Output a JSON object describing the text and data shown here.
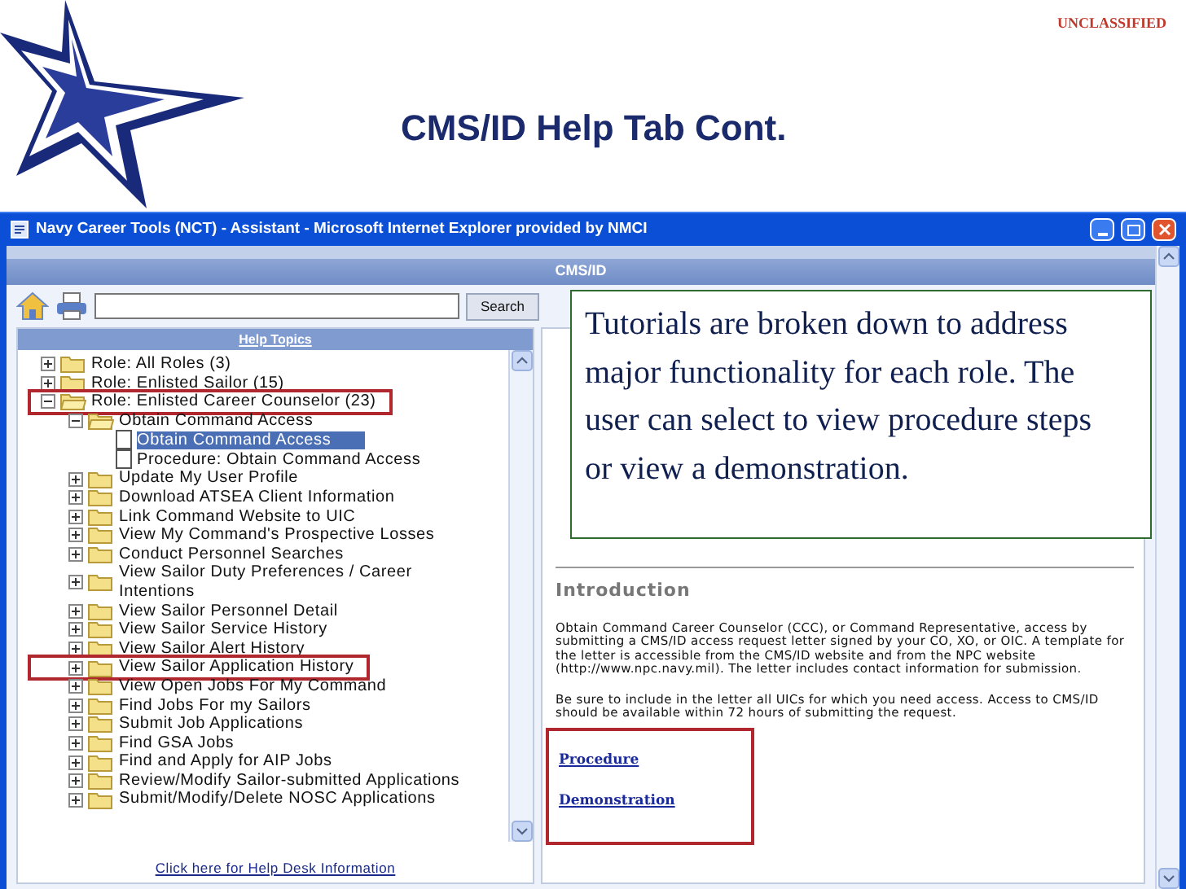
{
  "classification": "UNCLASSIFIED",
  "slide_title": "CMS/ID Help Tab Cont.",
  "window": {
    "title": "Navy Career Tools (NCT) - Assistant - Microsoft Internet Explorer provided by NMCI"
  },
  "page_header": "CMS/ID",
  "search": {
    "button": "Search"
  },
  "tree": {
    "title": "Help Topics",
    "items": [
      {
        "label": "Role: All Roles (3)",
        "kind": "folder",
        "expanded": false,
        "selected": false,
        "highlighted": false
      },
      {
        "label": "Role: Enlisted Sailor (15)",
        "kind": "folder",
        "expanded": false,
        "selected": false,
        "highlighted": false
      },
      {
        "label": "Role: Enlisted Career Counselor (23)",
        "kind": "folder",
        "expanded": true,
        "selected": false,
        "highlighted": true,
        "children": [
          {
            "label": "Obtain Command Access",
            "kind": "folder",
            "expanded": true,
            "selected": false,
            "highlighted": false,
            "children": [
              {
                "label": "Obtain Command Access",
                "kind": "doc",
                "selected": true,
                "highlighted": false
              },
              {
                "label": "Procedure: Obtain Command Access",
                "kind": "doc",
                "selected": false,
                "highlighted": false
              }
            ]
          },
          {
            "label": "Update My User Profile",
            "kind": "folder",
            "expanded": false,
            "selected": false,
            "highlighted": false
          },
          {
            "label": "Download ATSEA Client Information",
            "kind": "folder",
            "expanded": false,
            "selected": false,
            "highlighted": false
          },
          {
            "label": "Link Command Website to UIC",
            "kind": "folder",
            "expanded": false,
            "selected": false,
            "highlighted": false
          },
          {
            "label": "View My Command's Prospective Losses",
            "kind": "folder",
            "expanded": false,
            "selected": false,
            "highlighted": false
          },
          {
            "label": "Conduct Personnel Searches",
            "kind": "folder",
            "expanded": false,
            "selected": false,
            "highlighted": false
          },
          {
            "label": "View Sailor Duty Preferences / Career Intentions",
            "kind": "folder",
            "expanded": false,
            "selected": false,
            "highlighted": false
          },
          {
            "label": "View Sailor Personnel Detail",
            "kind": "folder",
            "expanded": false,
            "selected": false,
            "highlighted": false
          },
          {
            "label": "View Sailor Service History",
            "kind": "folder",
            "expanded": false,
            "selected": false,
            "highlighted": false
          },
          {
            "label": "View Sailor Alert History",
            "kind": "folder",
            "expanded": false,
            "selected": false,
            "highlighted": false
          },
          {
            "label": "View Sailor Application History",
            "kind": "folder",
            "expanded": false,
            "selected": false,
            "highlighted": true
          },
          {
            "label": "View Open Jobs For My Command",
            "kind": "folder",
            "expanded": false,
            "selected": false,
            "highlighted": false
          },
          {
            "label": "Find Jobs For my Sailors",
            "kind": "folder",
            "expanded": false,
            "selected": false,
            "highlighted": false
          },
          {
            "label": "Submit Job Applications",
            "kind": "folder",
            "expanded": false,
            "selected": false,
            "highlighted": false
          },
          {
            "label": "Find GSA Jobs",
            "kind": "folder",
            "expanded": false,
            "selected": false,
            "highlighted": false
          },
          {
            "label": "Find and Apply for AIP Jobs",
            "kind": "folder",
            "expanded": false,
            "selected": false,
            "highlighted": false
          },
          {
            "label": "Review/Modify Sailor-submitted Applications",
            "kind": "folder",
            "expanded": false,
            "selected": false,
            "highlighted": false
          },
          {
            "label": "Submit/Modify/Delete NOSC Applications",
            "kind": "folder",
            "expanded": false,
            "selected": false,
            "highlighted": false
          }
        ]
      }
    ]
  },
  "help_desk_link": "Click here for Help Desk Information",
  "content": {
    "heading": "Introduction",
    "paragraphs": [
      "Obtain Command Career Counselor (CCC), or Command Representative, access by submitting a CMS/ID access request letter signed by your CO, XO, or OIC. A template for the letter is accessible from the CMS/ID website and from the NPC website (http://www.npc.navy.mil). The letter includes contact information for submission.",
      "Be sure to include in the letter all UICs for which you need access.  Access to CMS/ID should be available within 72 hours of submitting the request."
    ],
    "links": {
      "highlighted": true,
      "items": [
        "Procedure",
        "Demonstration"
      ]
    }
  },
  "callout": "Tutorials are broken down to address major functionality for each role. The user can select to view procedure steps or view a demonstration."
}
